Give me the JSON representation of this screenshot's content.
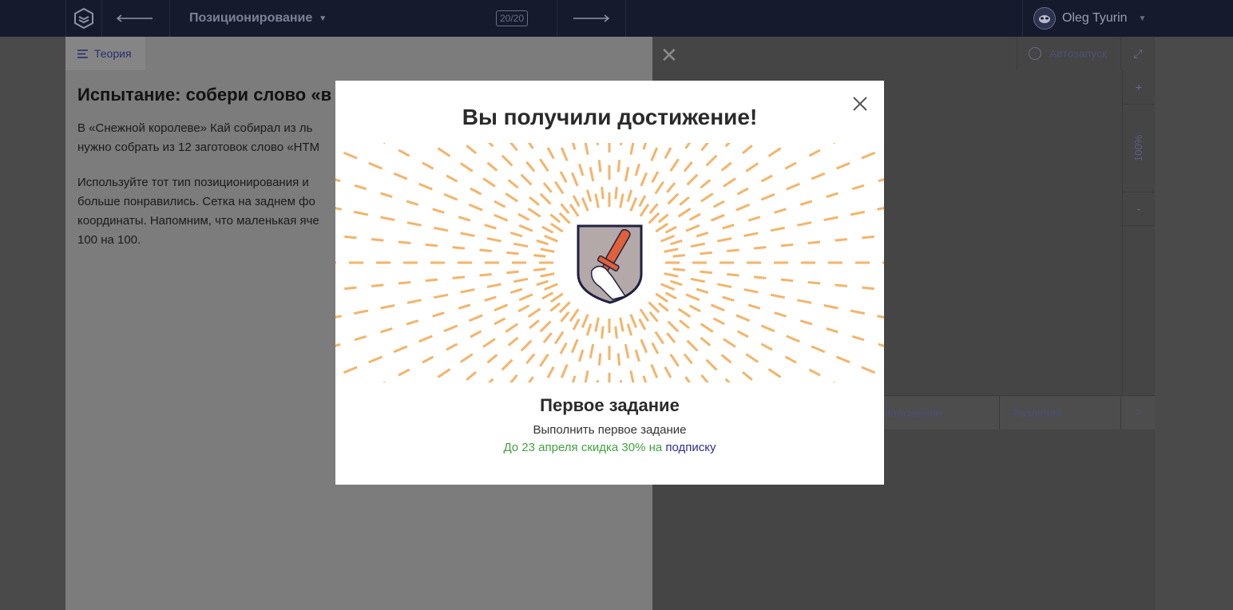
{
  "header": {
    "course_title": "Позиционирование",
    "counter": "20/20",
    "user_name": "Oleg Tyurin"
  },
  "theory": {
    "tab_label": "Теория",
    "heading": "Испытание: собери слово «в",
    "paragraph1": "В «Снежной королеве» Кай собирал из ль​нужно собрать из 12 заготовок слово «HTM",
    "paragraph1_lines": [
      "В «Снежной королеве» Кай собирал из ль",
      "нужно собрать из 12 заготовок слово «HTM"
    ],
    "paragraph2_lines": [
      "Используйте тот тип позиционирования и",
      "больше понравились. Сетка на заднем фо",
      "координаты. Напомним, что маленькая яче",
      "100 на 100."
    ]
  },
  "preview": {
    "autorun_label": "Автозапуск",
    "zoom_plus": "+",
    "zoom_level": "100%",
    "zoom_minus": "-",
    "tabs": [
      "Наложение",
      "Различия",
      "?"
    ]
  },
  "modal": {
    "title": "Вы получили достижение!",
    "achievement_title": "Первое задание",
    "achievement_desc": "Выполнить первое задание",
    "promo_text": "До 23 апреля скидка 30% на ",
    "promo_link": "подписку"
  },
  "colors": {
    "ray": "#f4b46a",
    "shield_fill": "#b3a9a9",
    "shield_border": "#1f2140",
    "sword": "#e0603a",
    "promo_green": "#3fa33f",
    "link_blue": "#2e2f8c"
  }
}
